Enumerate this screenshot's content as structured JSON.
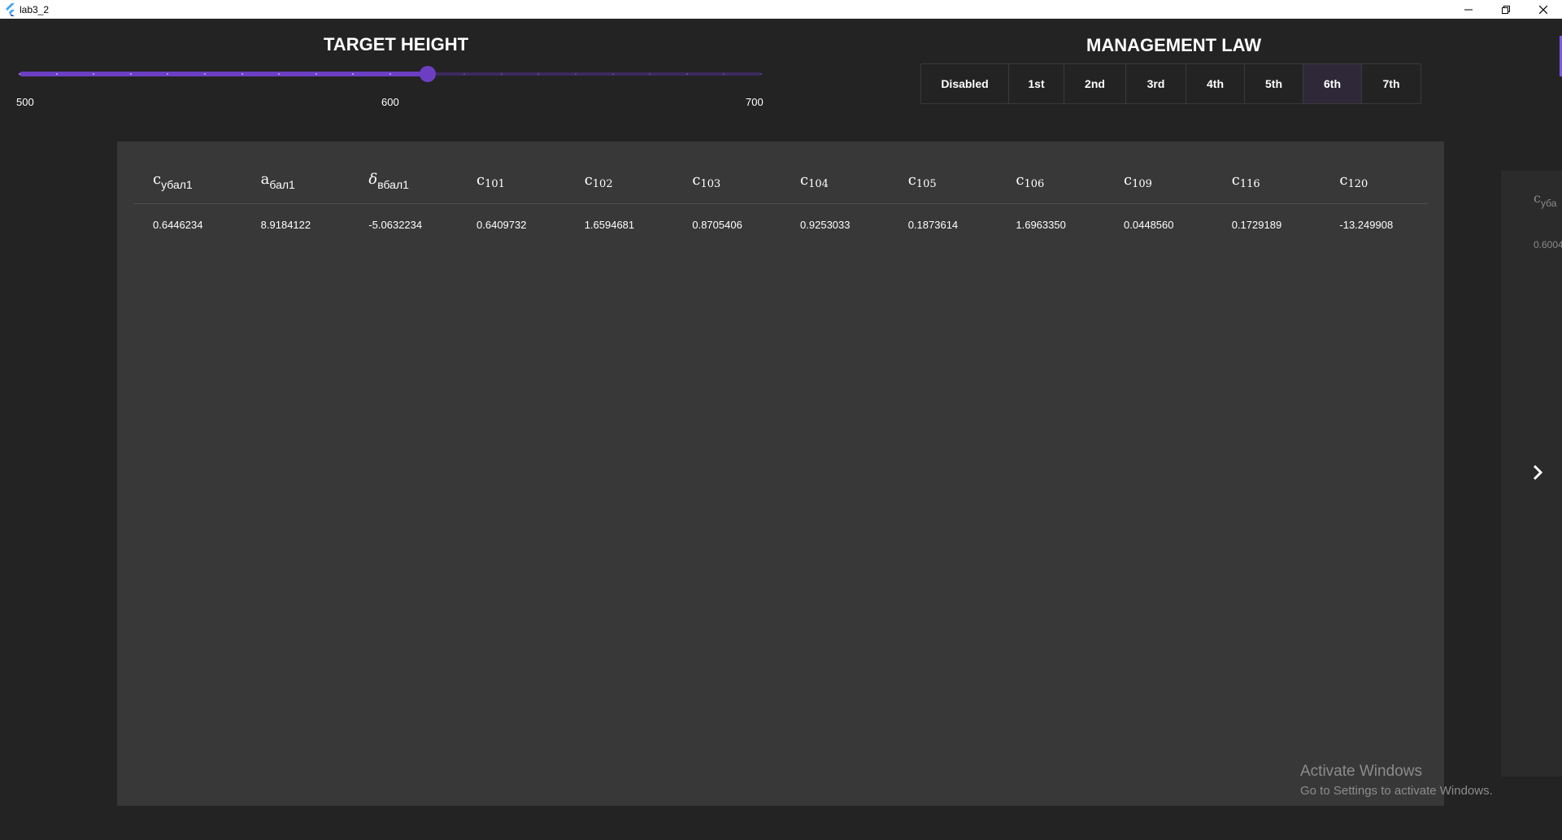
{
  "window": {
    "title": "lab3_2",
    "controls": [
      "minimize-icon",
      "restore-icon",
      "close-icon"
    ]
  },
  "target_height": {
    "title": "TARGET HEIGHT",
    "min_label": "500",
    "mid_label": "600",
    "max_label": "700",
    "min": 500,
    "max": 700,
    "value": 610,
    "divisions": 20,
    "accent_color": "#6c3fc2"
  },
  "management_law": {
    "title": "MANAGEMENT LAW",
    "options": [
      "Disabled",
      "1st",
      "2nd",
      "3rd",
      "4th",
      "5th",
      "6th",
      "7th"
    ],
    "selected": "6th"
  },
  "table": {
    "headers": [
      {
        "base": "c",
        "sub": "убал1"
      },
      {
        "base": "a",
        "sub": "бал1"
      },
      {
        "base": "δ",
        "sub": "вбал1"
      },
      {
        "base": "c",
        "sub": "101"
      },
      {
        "base": "c",
        "sub": "102"
      },
      {
        "base": "c",
        "sub": "103"
      },
      {
        "base": "c",
        "sub": "104"
      },
      {
        "base": "c",
        "sub": "105"
      },
      {
        "base": "c",
        "sub": "106"
      },
      {
        "base": "c",
        "sub": "109"
      },
      {
        "base": "c",
        "sub": "116"
      },
      {
        "base": "c",
        "sub": "120"
      }
    ],
    "rows": [
      [
        "0.6446234",
        "8.9184122",
        "-5.0632234",
        "0.6409732",
        "1.6594681",
        "0.8705406",
        "0.9253033",
        "0.1873614",
        "1.6963350",
        "0.0448560",
        "0.1729189",
        "-13.249908"
      ]
    ]
  },
  "peek_card": {
    "header_base": "c",
    "header_sub": "уба",
    "value": "0.6004"
  },
  "watermark": {
    "line1": "Activate Windows",
    "line2": "Go to Settings to activate Windows."
  }
}
